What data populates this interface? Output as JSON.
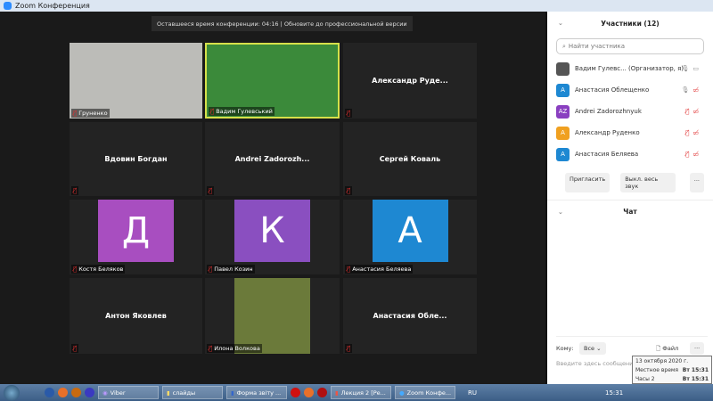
{
  "window": {
    "title": "Zoom Конференция"
  },
  "banner": "Оставшееся время конференции: 04:16 | Обновите до профессиональной версии",
  "tiles": [
    {
      "name": "Груненко",
      "type": "video",
      "bg": "#bcbcb8"
    },
    {
      "name": "Вадим Гулевський",
      "type": "video",
      "bg": "#3b8a3a",
      "active": true
    },
    {
      "center": "Александр Руде...",
      "type": "name"
    },
    {
      "center": "Вдовин Богдан",
      "type": "name"
    },
    {
      "center": "Andrei Zadorozh...",
      "type": "name"
    },
    {
      "center": "Сергей Коваль",
      "type": "name"
    },
    {
      "name": "Костя Беляков",
      "letter": "Д",
      "color": "#a84ec0",
      "type": "avatar"
    },
    {
      "name": "Павел Козин",
      "letter": "К",
      "color": "#8a4fc0",
      "type": "avatar"
    },
    {
      "name": "Анастасия Беляева",
      "letter": "А",
      "color": "#1e88d2",
      "type": "avatar"
    },
    {
      "center": "Антон Яковлев",
      "type": "name"
    },
    {
      "name": "Илона Волкова",
      "type": "video",
      "bg": "#6b7a3a"
    },
    {
      "center": "Анастасия Обле...",
      "type": "name"
    }
  ],
  "participants": {
    "title": "Участники (12)",
    "search_placeholder": "Найти участника",
    "items": [
      {
        "name": "Вадим Гулевс...  (Организатор, я)",
        "initials": "",
        "color": "#555",
        "mic": "on",
        "video": "on"
      },
      {
        "name": "Анастасия Облещенко",
        "initials": "A",
        "color": "#1e88d2",
        "mic": "on",
        "video": "off"
      },
      {
        "name": "Andrei Zadorozhnyuk",
        "initials": "AZ",
        "color": "#8a3fc0",
        "mic": "muted",
        "video": "off"
      },
      {
        "name": "Александр Руденко",
        "initials": "A",
        "color": "#f0a020",
        "mic": "muted",
        "video": "off"
      },
      {
        "name": "Анастасия Беляева",
        "initials": "A",
        "color": "#1e88d2",
        "mic": "muted",
        "video": "off"
      }
    ],
    "invite": "Пригласить",
    "mute_all": "Выкл. весь звук",
    "more": "..."
  },
  "chat": {
    "title": "Чат",
    "to_label": "Кому:",
    "to_value": "Все",
    "file": "Файл",
    "more": "···",
    "placeholder": "Введите здесь сообщение..."
  },
  "tooltip": {
    "date": "13 октября 2020 г.",
    "local_label": "Местное время",
    "local_value": "Вт 15:31",
    "clock2_label": "Часы 2",
    "clock2_value": "Вт 15:31"
  },
  "taskbar": {
    "items": [
      "Viber",
      "слайды",
      "Форма звіту ...",
      "Лекция 2 [Ре...",
      "Zoom Конфе..."
    ],
    "lang": "RU",
    "clock": "15:31"
  }
}
